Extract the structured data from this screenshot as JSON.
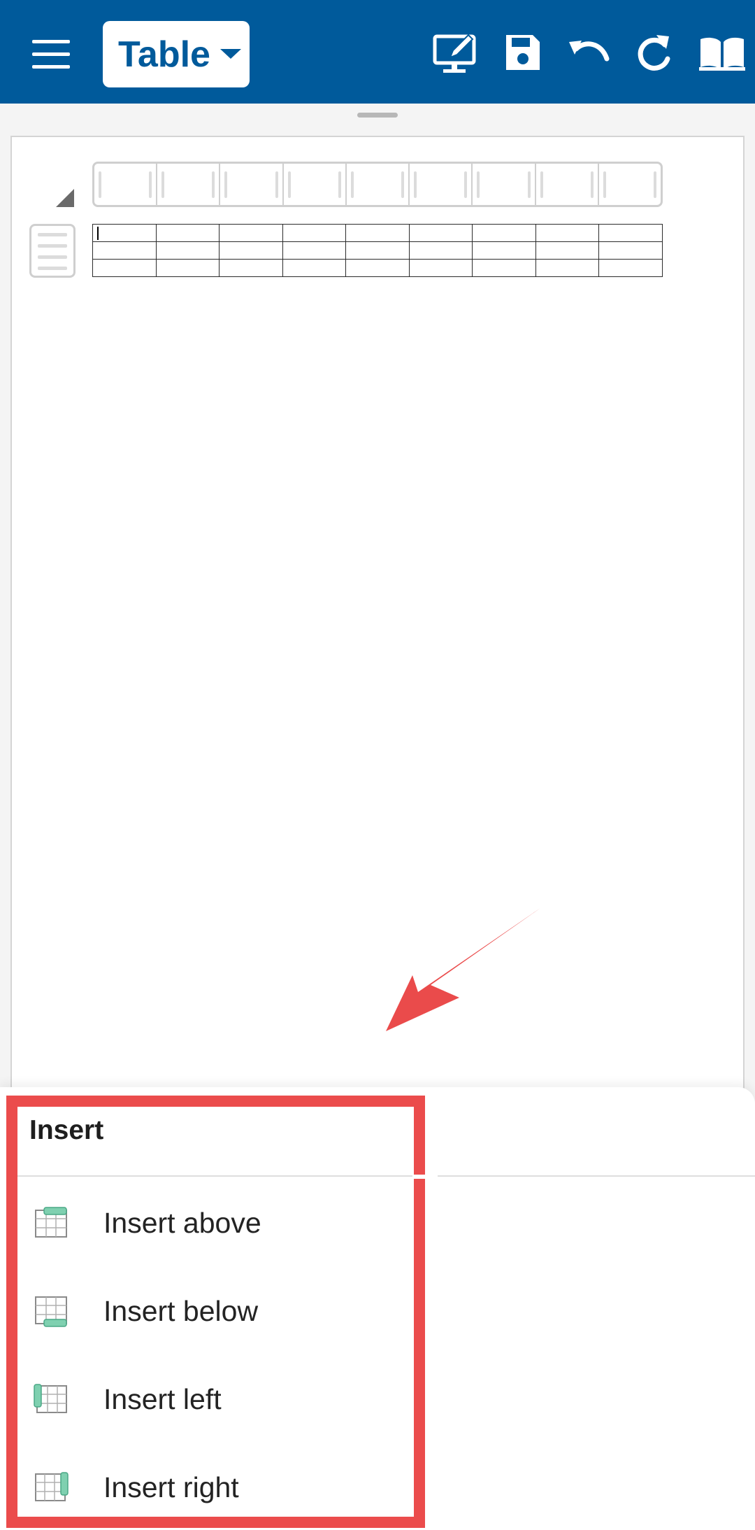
{
  "toolbar": {
    "mode_label": "Table",
    "icons": [
      "menu-icon",
      "edit-screen-icon",
      "save-icon",
      "undo-icon",
      "redo-icon",
      "read-mode-icon"
    ],
    "background": "#005a9b"
  },
  "document": {
    "table_columns": 9,
    "table_rows": 3
  },
  "insert_menu": {
    "title": "Insert",
    "items": [
      {
        "label": "Insert above",
        "icon": "insert-row-above-icon"
      },
      {
        "label": "Insert below",
        "icon": "insert-row-below-icon"
      },
      {
        "label": "Insert left",
        "icon": "insert-column-left-icon"
      },
      {
        "label": "Insert right",
        "icon": "insert-column-right-icon"
      }
    ]
  },
  "colors": {
    "accent": "#005a9b",
    "highlight": "#eb4c4c",
    "insert_marker": "#7fd0b0"
  }
}
